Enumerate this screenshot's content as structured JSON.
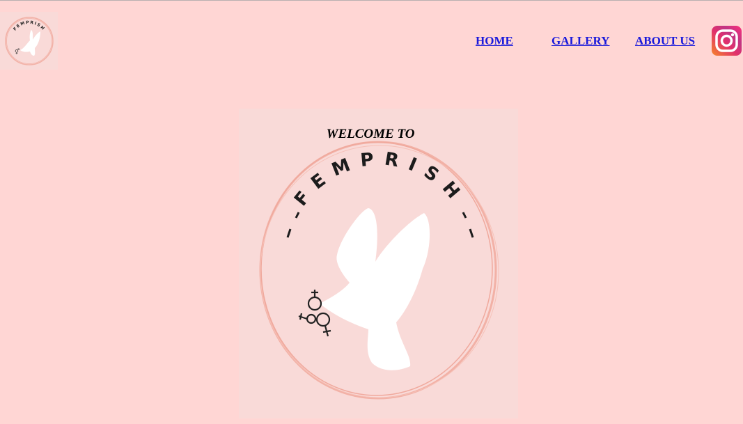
{
  "header": {
    "logo_text": "FEMPRISH",
    "nav": {
      "home": "HOME",
      "gallery": "GALLERY",
      "about": "ABOUT US"
    },
    "social_icon": "instagram-icon"
  },
  "hero": {
    "welcome": "WELCOME TO",
    "logo_text": "FEMPRISH",
    "logo_icon": "dove-icon"
  },
  "colors": {
    "background": "#ffd6d4",
    "panel": "#f9dad8",
    "ring": "#f2b1a6",
    "link": "#1a1adb"
  }
}
